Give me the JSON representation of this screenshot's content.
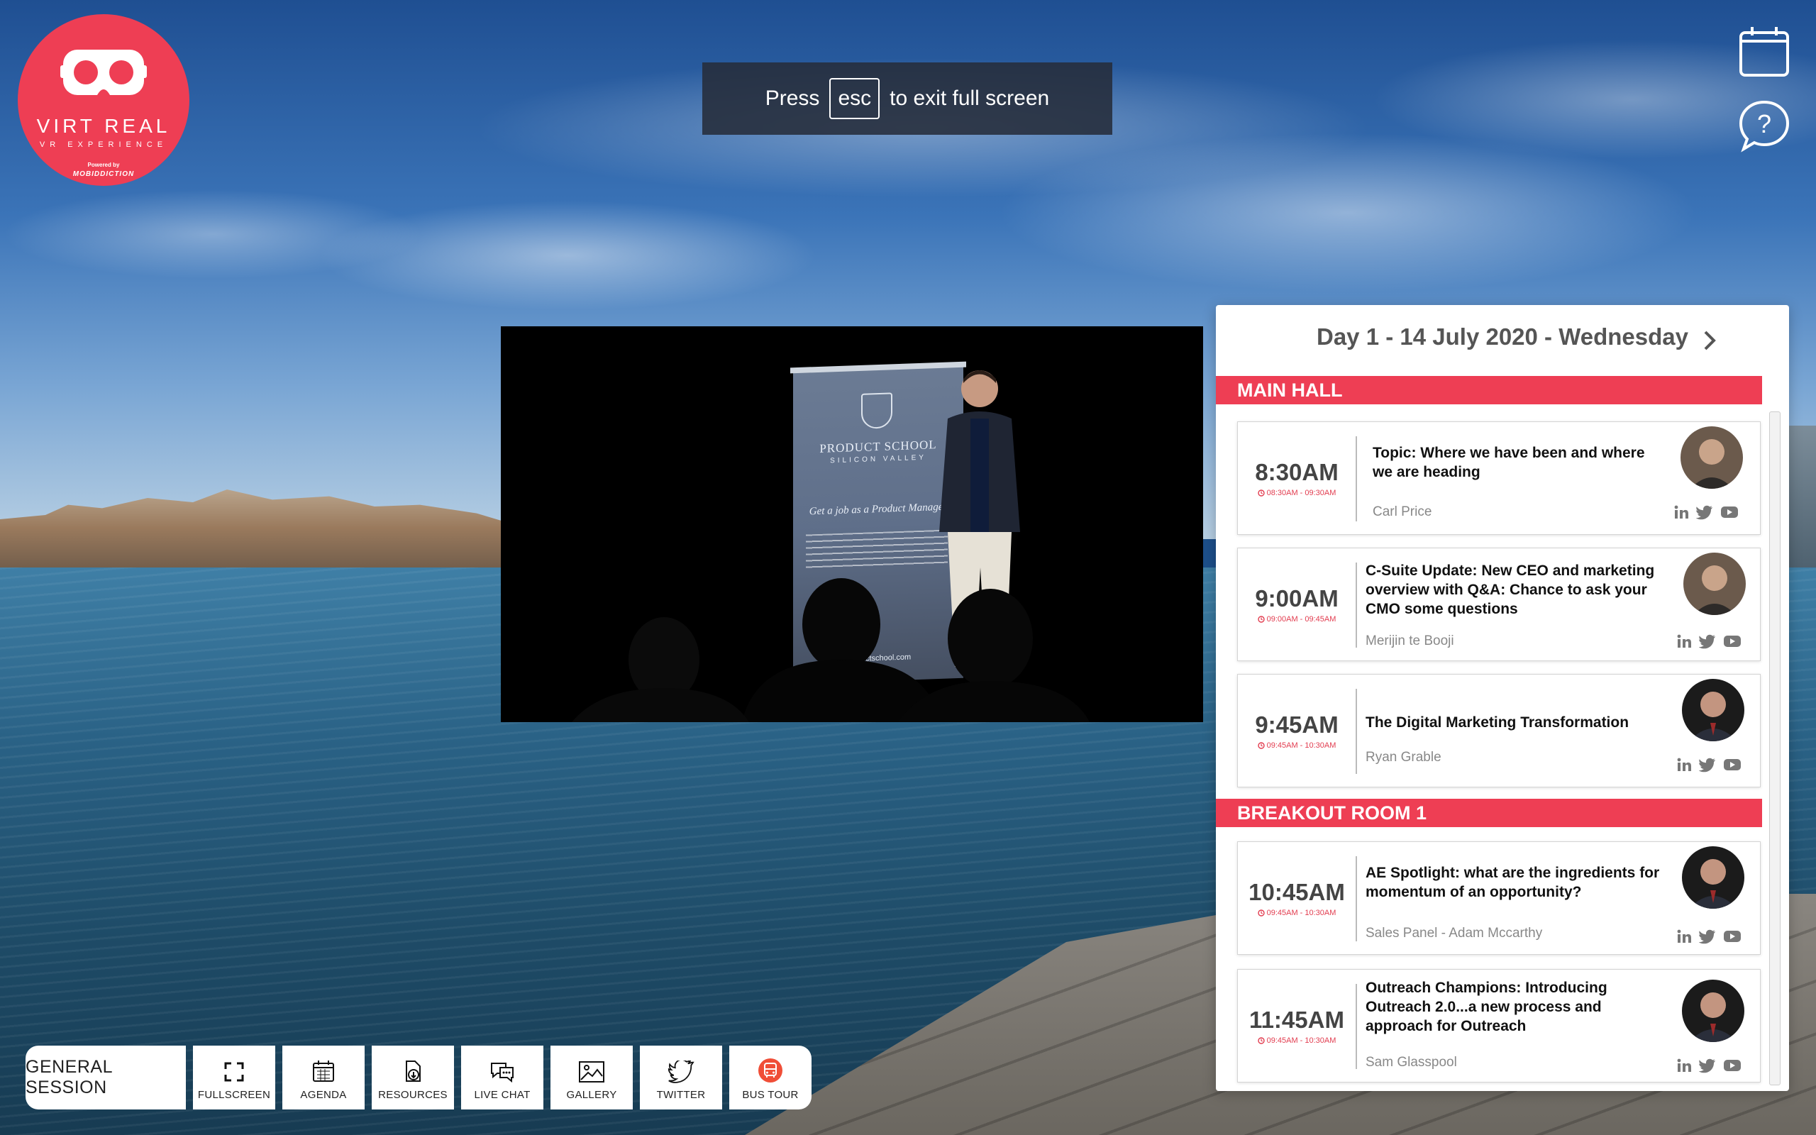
{
  "logo": {
    "title": "VIRT REAL",
    "subtitle": "VR EXPERIENCE",
    "powered_by": "Powered by",
    "brand": "MOBIDDICTION",
    "color": "#ee3e54"
  },
  "banner": {
    "press": "Press",
    "key": "esc",
    "message": "to exit full screen"
  },
  "top_icons": [
    "calendar-icon",
    "help-icon"
  ],
  "video": {
    "banner_title": "PRODUCT SCHOOL",
    "banner_sub": "SILICON VALLEY",
    "banner_tagline": "Get a job as a Product Manager",
    "banner_url": "productschool.com"
  },
  "toolbar": {
    "session_label": "GENERAL SESSION",
    "buttons": [
      {
        "label": "FULLSCREEN",
        "icon": "fullscreen-icon"
      },
      {
        "label": "AGENDA",
        "icon": "calendar-icon"
      },
      {
        "label": "RESOURCES",
        "icon": "download-icon"
      },
      {
        "label": "LIVE CHAT",
        "icon": "chat-icon"
      },
      {
        "label": "GALLERY",
        "icon": "image-icon"
      },
      {
        "label": "TWITTER",
        "icon": "twitter-icon"
      },
      {
        "label": "BUS TOUR",
        "icon": "bus-icon"
      }
    ]
  },
  "agenda": {
    "day_title": "Day 1 - 14 July 2020 - Wednesday",
    "accent_color": "#ee3e54",
    "rooms": [
      {
        "name": "MAIN HALL",
        "sessions": [
          {
            "time": "8:30AM",
            "range": "08:30AM - 09:30AM",
            "title": "Topic: Where we have been and where we are heading",
            "speaker": "Carl Price"
          },
          {
            "time": "9:00AM",
            "range": "09:00AM - 09:45AM",
            "title": "C-Suite Update: New CEO and marketing overview with Q&A: Chance to ask your CMO some questions",
            "speaker": "Merijin te Booji"
          },
          {
            "time": "9:45AM",
            "range": "09:45AM - 10:30AM",
            "title": "The Digital Marketing Transformation",
            "speaker": "Ryan Grable"
          }
        ]
      },
      {
        "name": "BREAKOUT ROOM 1",
        "sessions": [
          {
            "time": "10:45AM",
            "range": "09:45AM - 10:30AM",
            "title": "AE Spotlight: what are the ingredients for momentum of an opportunity?",
            "speaker": "Sales Panel - Adam Mccarthy"
          },
          {
            "time": "11:45AM",
            "range": "09:45AM - 10:30AM",
            "title": "Outreach Champions: Introducing Outreach 2.0...a new process and approach for Outreach",
            "speaker": "Sam Glasspool"
          }
        ]
      }
    ],
    "social_icons": [
      "linkedin-icon",
      "twitter-icon",
      "youtube-icon"
    ]
  }
}
